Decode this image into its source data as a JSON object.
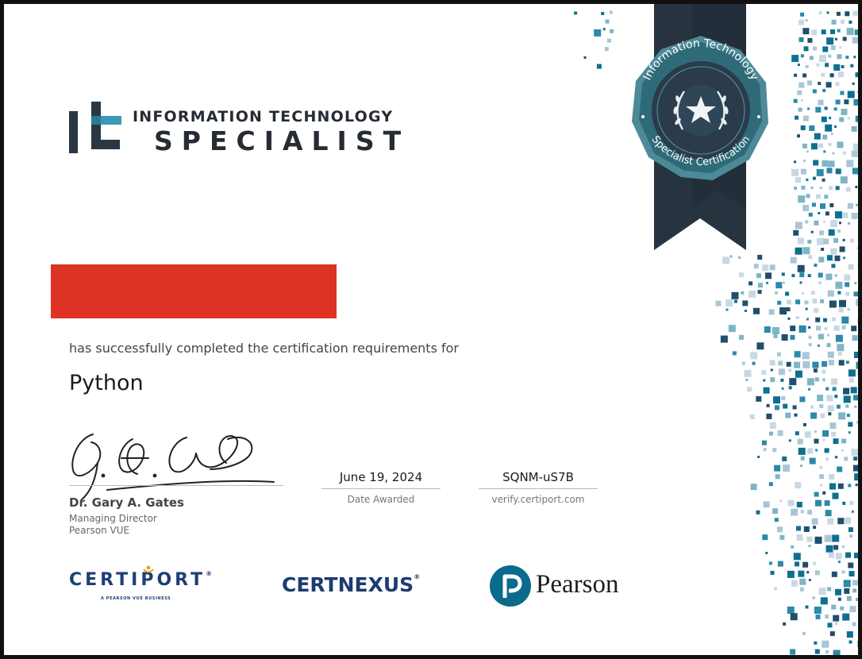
{
  "brand": {
    "line1": "INFORMATION TECHNOLOGY",
    "line2": "SPECIALIST"
  },
  "seal": {
    "top_text": "Information Technology",
    "bottom_text": "Specialist Certification"
  },
  "certificate": {
    "recipient_name": "",
    "statement": "has successfully completed the certification requirements for",
    "program": "Python"
  },
  "signer": {
    "name": "Dr. Gary A. Gates",
    "title": "Managing Director",
    "organization": "Pearson VUE"
  },
  "award": {
    "date": "June 19, 2024",
    "date_caption": "Date Awarded",
    "code": "SQNM-uS7B",
    "code_caption": "verify.certiport.com"
  },
  "partners": {
    "certiport": "CERTIPORT",
    "certiport_tagline": "A PEARSON VUE BUSINESS",
    "certnexus": "CERTNEXUS",
    "pearson": "Pearson"
  },
  "colors": {
    "redaction": "#dc3324",
    "seal_navy": "#2b3b4b",
    "seal_teal": "#4d8a97",
    "pattern": [
      "#0f6f8f",
      "#2a8aa8",
      "#7fb5c5",
      "#a9c6d6",
      "#c9d8e2",
      "#1f4f6e"
    ]
  },
  "icons": [
    "it-logo-icon",
    "laurel-star-icon",
    "pearson-p-icon",
    "certiport-person-icon"
  ]
}
